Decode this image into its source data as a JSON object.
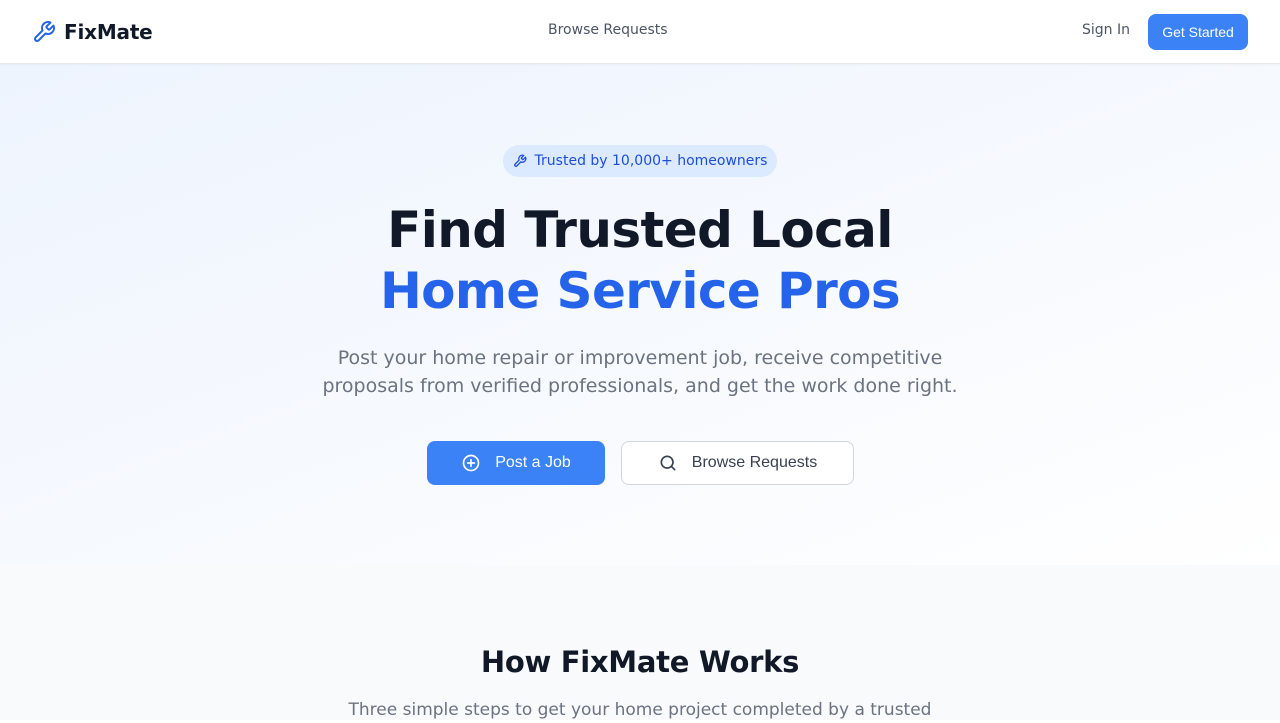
{
  "nav": {
    "brand": "FixMate",
    "browse_link": "Browse Requests",
    "sign_in": "Sign In",
    "cta": "Get Started"
  },
  "hero": {
    "badge": "Trusted by 10,000+ homeowners",
    "headline_line1": "Find Trusted Local",
    "headline_line2": "Home Service Pros",
    "subtext": "Post your home repair or improvement job, receive competitive proposals from verified professionals, and get the work done right.",
    "primary_button": "Post a Job",
    "secondary_button": "Browse Requests"
  },
  "how": {
    "title": "How FixMate Works",
    "subtitle": "Three simple steps to get your home project completed by a trusted"
  },
  "icons": {
    "brand": "wrench-icon",
    "badge": "wrench-icon",
    "primary": "plus-circle-icon",
    "secondary": "search-icon"
  },
  "colors": {
    "accent": "#3b82f6",
    "accent_dark": "#2563eb",
    "badge_bg": "#dbeafe",
    "badge_text": "#1d4ed8",
    "text_dark": "#111827",
    "text_muted": "#6b7280"
  }
}
